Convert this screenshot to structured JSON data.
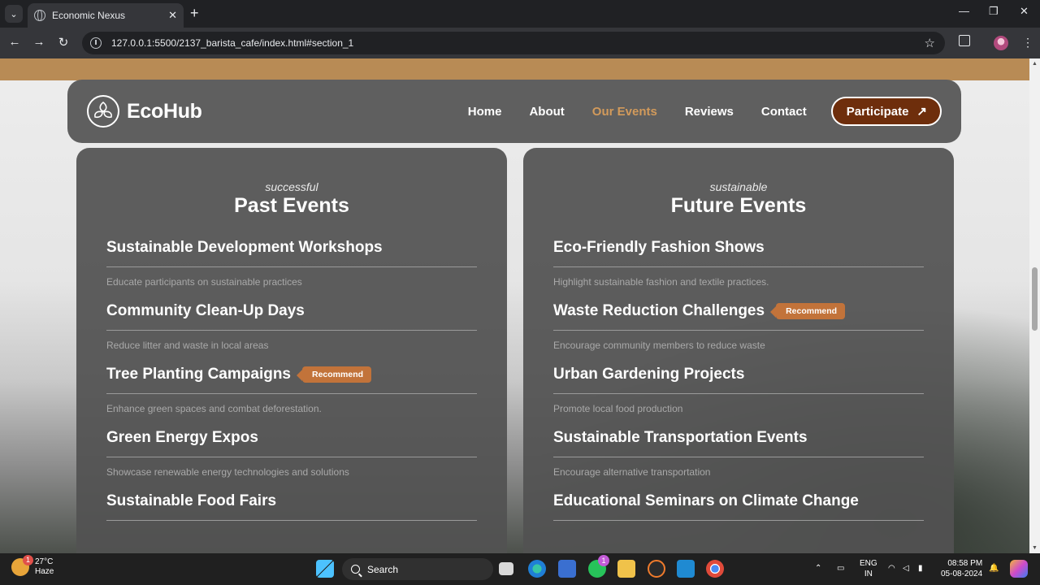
{
  "browser": {
    "tab_title": "Economic Nexus",
    "url": "127.0.0.1:5500/2137_barista_cafe/index.html#section_1"
  },
  "navbar": {
    "brand": "EcoHub",
    "links": [
      "Home",
      "About",
      "Our Events",
      "Reviews",
      "Contact"
    ],
    "active_link": "Our Events",
    "cta": "Participate",
    "cta_arrow": "↗"
  },
  "past_events": {
    "eyebrow": "successful",
    "heading": "Past Events",
    "items": [
      {
        "title": "Sustainable Development Workshops",
        "desc": "Educate participants on sustainable practices",
        "badge": ""
      },
      {
        "title": "Community Clean-Up Days",
        "desc": "Reduce litter and waste in local areas",
        "badge": ""
      },
      {
        "title": "Tree Planting Campaigns",
        "desc": "Enhance green spaces and combat deforestation.",
        "badge": "Recommend"
      },
      {
        "title": "Green Energy Expos",
        "desc": "Showcase renewable energy technologies and solutions",
        "badge": ""
      },
      {
        "title": "Sustainable Food Fairs",
        "desc": "",
        "badge": ""
      }
    ]
  },
  "future_events": {
    "eyebrow": "sustainable",
    "heading": "Future Events",
    "items": [
      {
        "title": "Eco-Friendly Fashion Shows",
        "desc": "Highlight sustainable fashion and textile practices.",
        "badge": ""
      },
      {
        "title": "Waste Reduction Challenges",
        "desc": "Encourage community members to reduce waste",
        "badge": "Recommend"
      },
      {
        "title": "Urban Gardening Projects",
        "desc": "Promote local food production",
        "badge": ""
      },
      {
        "title": "Sustainable Transportation Events",
        "desc": "Encourage alternative transportation",
        "badge": ""
      },
      {
        "title": "Educational Seminars on Climate Change",
        "desc": "",
        "badge": ""
      }
    ]
  },
  "taskbar": {
    "weather_temp": "27°C",
    "weather_desc": "Haze",
    "weather_badge": "1",
    "search_label": "Search",
    "whatsapp_badge": "1",
    "lang_line1": "ENG",
    "lang_line2": "IN",
    "time": "08:58 PM",
    "date": "05-08-2024"
  },
  "colors": {
    "accent": "#d29a5b",
    "cta_bg": "#6e2e0c",
    "badge_bg": "#c2733a",
    "top_band": "#b88b55"
  }
}
